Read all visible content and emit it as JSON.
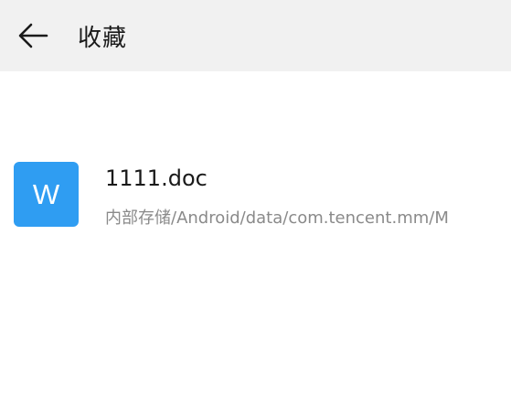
{
  "header": {
    "back_icon": "arrow-left-icon",
    "title": "收藏"
  },
  "favorites": [
    {
      "icon_letter": "W",
      "icon_color": "#2f9df2",
      "name": "1111.doc",
      "path": "内部存储/Android/data/com.tencent.mm/M"
    }
  ],
  "colors": {
    "header_bg": "#f1f1f1",
    "accent": "#2f9df2",
    "secondary_text": "#8a8a8a"
  }
}
